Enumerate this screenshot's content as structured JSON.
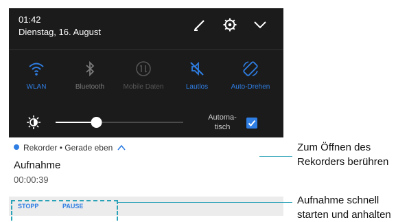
{
  "status": {
    "time": "01:42",
    "date": "Dienstag, 16. August"
  },
  "tiles": [
    {
      "label": "WLAN",
      "icon": "wifi-icon",
      "active": true
    },
    {
      "label": "Bluetooth",
      "icon": "bluetooth-icon",
      "active": false
    },
    {
      "label": "Mobile Daten",
      "icon": "mobile-data-icon",
      "active": false
    },
    {
      "label": "Lautlos",
      "icon": "silent-icon",
      "active": true
    },
    {
      "label": "Auto-Drehen",
      "icon": "auto-rotate-icon",
      "active": true
    }
  ],
  "brightness": {
    "level": 0.32,
    "auto_line1": "Automa-",
    "auto_line2": "tisch",
    "auto_checked": true
  },
  "notification": {
    "app": "Rekorder",
    "when": "Gerade eben",
    "title": "Aufnahme",
    "elapsed": "00:00:39",
    "actions": {
      "stop": "STOPP",
      "pause": "PAUSE"
    }
  },
  "callouts": {
    "open_line1": "Zum Öffnen des",
    "open_line2": "Rekorders berühren",
    "control_line1": "Aufnahme schnell",
    "control_line2": "starten und anhalten"
  },
  "colors": {
    "accent": "#2f7ee3",
    "shade": "#1b1b1b",
    "callout": "#2aa3b8",
    "inactive": "#6b6b6b"
  }
}
